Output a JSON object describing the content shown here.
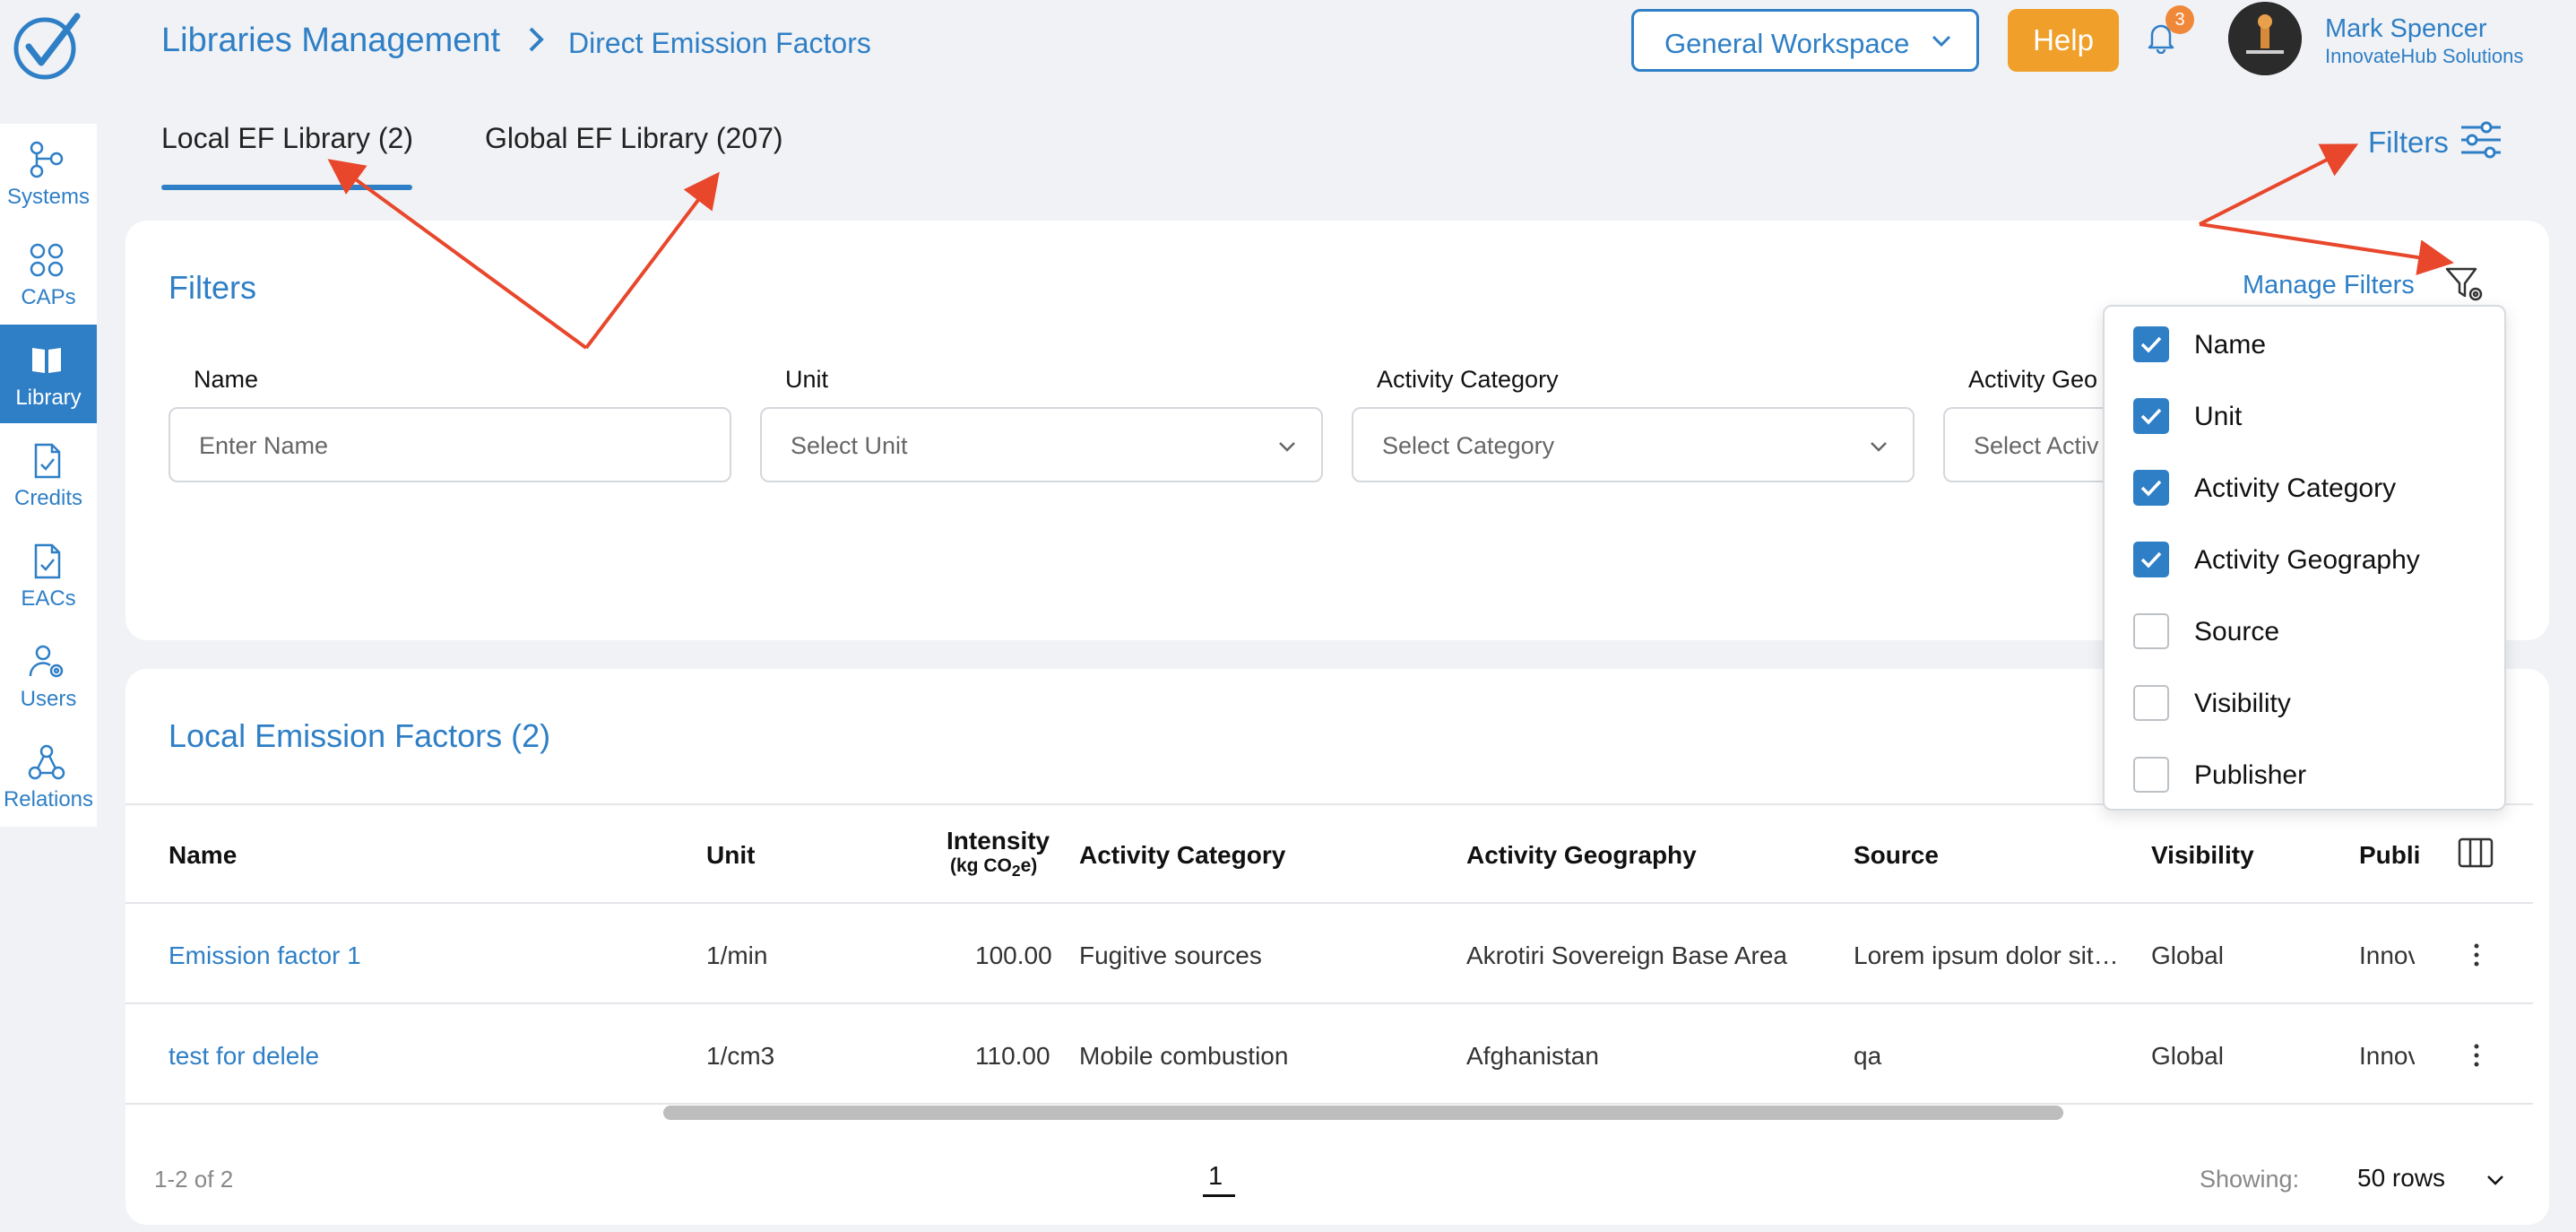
{
  "header": {
    "breadcrumb_main": "Libraries Management",
    "breadcrumb_sub": "Direct Emission Factors",
    "workspace": "General Workspace",
    "help": "Help",
    "notification_count": "3",
    "user_name": "Mark Spencer",
    "user_org": "InnovateHub Solutions"
  },
  "sidebar": {
    "items": [
      {
        "label": "Systems",
        "icon": "systems-icon"
      },
      {
        "label": "CAPs",
        "icon": "caps-icon"
      },
      {
        "label": "Library",
        "icon": "library-icon",
        "active": true
      },
      {
        "label": "Credits",
        "icon": "credits-icon"
      },
      {
        "label": "EACs",
        "icon": "eacs-icon"
      },
      {
        "label": "Users",
        "icon": "users-icon"
      },
      {
        "label": "Relations",
        "icon": "relations-icon"
      }
    ]
  },
  "tabs": {
    "local": "Local EF Library (2)",
    "global": "Global EF Library (207)",
    "filters": "Filters"
  },
  "filter_panel": {
    "title": "Filters",
    "manage": "Manage Filters",
    "fields": [
      {
        "label": "Name",
        "placeholder": "Enter Name"
      },
      {
        "label": "Unit",
        "placeholder": "Select Unit"
      },
      {
        "label": "Activity Category",
        "placeholder": "Select Category"
      },
      {
        "label": "Activity Geo",
        "placeholder": "Select Activ"
      }
    ]
  },
  "manage_dropdown": {
    "options": [
      {
        "label": "Name",
        "checked": true
      },
      {
        "label": "Unit",
        "checked": true
      },
      {
        "label": "Activity Category",
        "checked": true
      },
      {
        "label": "Activity Geography",
        "checked": true
      },
      {
        "label": "Source",
        "checked": false
      },
      {
        "label": "Visibility",
        "checked": false
      },
      {
        "label": "Publisher",
        "checked": false
      }
    ]
  },
  "table": {
    "title": "Local Emission Factors (2)",
    "columns": {
      "name": "Name",
      "unit": "Unit",
      "intensity": "Intensity",
      "intensity_unit_pre": "(kg CO",
      "intensity_unit_sub": "2",
      "intensity_unit_post": "e)",
      "category": "Activity Category",
      "geography": "Activity Geography",
      "source": "Source",
      "visibility": "Visibility",
      "publisher": "Publi"
    },
    "rows": [
      {
        "name": "Emission factor 1",
        "unit": "1/min",
        "intensity": "100.00",
        "category": "Fugitive sources",
        "geography": "Akrotiri Sovereign Base Area",
        "source": "Lorem ipsum dolor sit…",
        "visibility": "Global",
        "publisher": "Innov"
      },
      {
        "name": "test for delele",
        "unit": "1/cm3",
        "intensity": "110.00",
        "category": "Mobile combustion",
        "geography": "Afghanistan",
        "source": "qa",
        "visibility": "Global",
        "publisher": "Innov"
      }
    ],
    "footer": {
      "count": "1-2 of 2",
      "page": "1",
      "showing": "Showing:",
      "rows": "50 rows"
    }
  },
  "colors": {
    "accent": "#2f7fc6",
    "help": "#f0a02a",
    "badge": "#f0883a",
    "annotation_arrow": "#e8472c"
  }
}
